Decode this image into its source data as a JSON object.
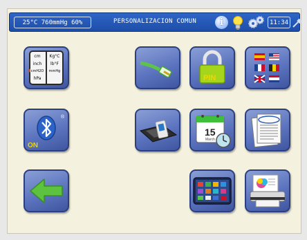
{
  "status": {
    "environment": "25°C 760mmHg 60%",
    "title": "PERSONALIZACION COMUN",
    "time": "11:34"
  },
  "icons": {
    "info": "info-icon",
    "bulb": "lightbulb-icon",
    "settings": "gears-icon",
    "connection": "plug-icon"
  },
  "tiles": {
    "units": {
      "col1": [
        "cm",
        "inch",
        "cmH2O",
        "hPa"
      ],
      "col2": [
        "Kg°C",
        "lb°F",
        "mmHg"
      ]
    },
    "pin_label": "PIN",
    "bluetooth_state": "ON",
    "calendar_day": "15",
    "calendar_month": "March",
    "bluetooth_mark": "®"
  },
  "colors": {
    "topbar": "#2563c4",
    "background": "#f4f1de",
    "tile": "#5c74bf",
    "accent_yellow": "#f2d400"
  }
}
